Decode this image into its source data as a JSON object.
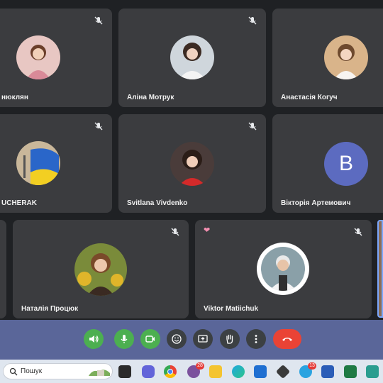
{
  "participants": [
    {
      "name": "нюклян",
      "muted": true
    },
    {
      "name": "Аліна Мотрук",
      "muted": true
    },
    {
      "name": "Анастасія Когуч",
      "muted": true
    },
    {
      "name": "UCHERAK",
      "muted": true
    },
    {
      "name": "Svitlana Vivdenko",
      "muted": true
    },
    {
      "name": "Вікторія Артемович",
      "muted": true,
      "initial": "B"
    },
    {
      "name": "Наталія Процюк",
      "muted": true
    },
    {
      "name": "Viktor Matiichuk",
      "muted": true,
      "reaction": "heart"
    }
  ],
  "colors": {
    "tile_bg": "#3b3c3f",
    "toolbar_bg": "#5a6699",
    "green": "#4caf50",
    "end_call": "#ea4335",
    "avatar_letter_bg": "#5c6bc0"
  },
  "toolbar": {
    "buttons": [
      "speaker-icon",
      "microphone-icon",
      "camera-icon",
      "emoji-icon",
      "present-screen-icon",
      "raise-hand-icon",
      "more-options-icon",
      "end-call-icon"
    ]
  },
  "taskbar": {
    "search_label": "Пошук",
    "badges": {
      "viber": "28",
      "telegram": "13"
    }
  }
}
